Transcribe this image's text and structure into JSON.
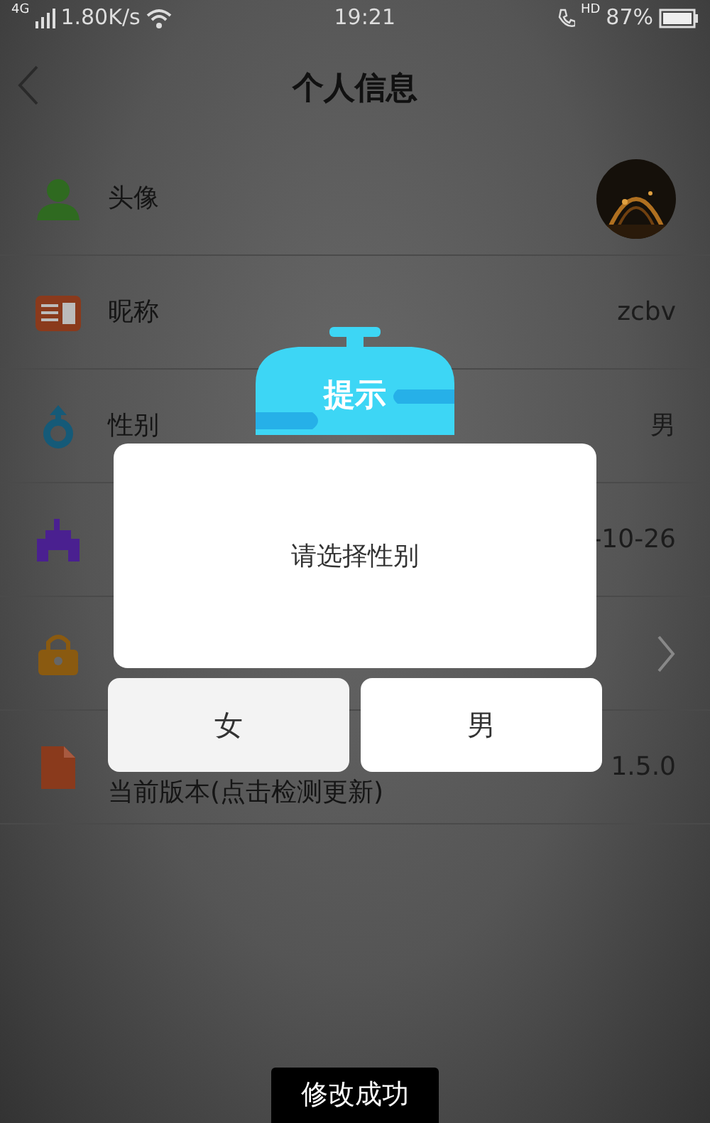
{
  "status_bar": {
    "network": "4G",
    "speed": "1.80K/s",
    "time": "19:21",
    "call": "HD",
    "battery": "87%"
  },
  "header": {
    "title": "个人信息"
  },
  "rows": [
    {
      "kind": "avatar",
      "label": "头像"
    },
    {
      "kind": "value",
      "label": "昵称",
      "value": "zcbv"
    },
    {
      "kind": "value",
      "label": "性别",
      "value": "男"
    },
    {
      "kind": "value",
      "value": "-10-26"
    },
    {
      "kind": "link"
    },
    {
      "kind": "value",
      "label": "当前版本(点击检测更新)",
      "value": "1.5.0"
    }
  ],
  "dialog": {
    "badge": "提示",
    "message": "请选择性别",
    "buttons": [
      {
        "label": "女",
        "selected": true
      },
      {
        "label": "男",
        "selected": false
      }
    ]
  },
  "toast": "修改成功"
}
